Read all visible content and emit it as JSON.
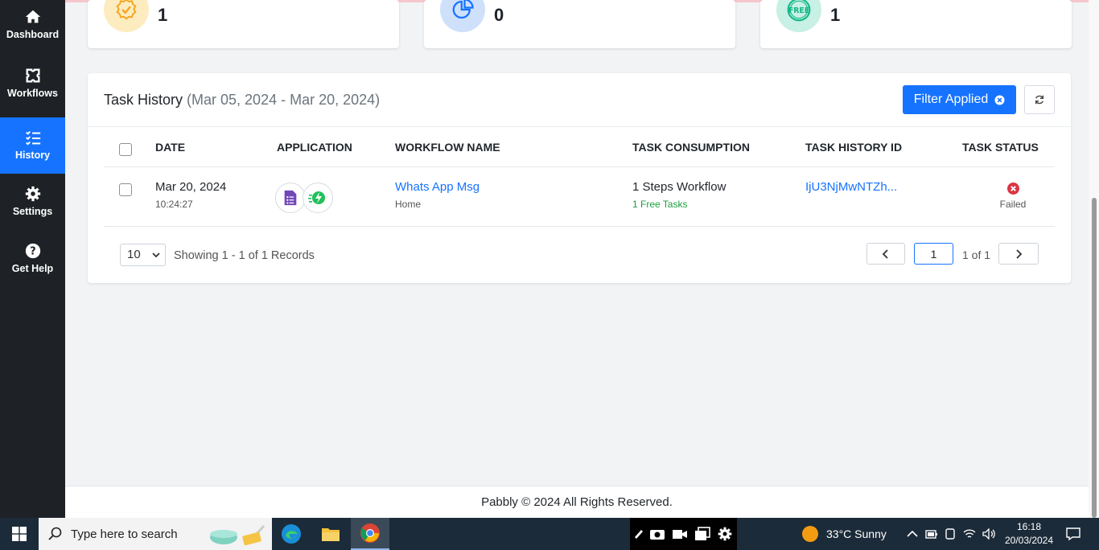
{
  "sidebar": {
    "items": [
      {
        "label": "Dashboard",
        "icon": "home-icon"
      },
      {
        "label": "Workflows",
        "icon": "workflow-icon"
      },
      {
        "label": "History",
        "icon": "list-icon",
        "active": true
      },
      {
        "label": "Settings",
        "icon": "gear-icon"
      },
      {
        "label": "Get Help",
        "icon": "help-icon"
      }
    ]
  },
  "stats": [
    {
      "value": "1",
      "icon": "badge-check-icon",
      "color": "#fdecc0"
    },
    {
      "value": "0",
      "icon": "pie-chart-icon",
      "color": "#cfe0fb"
    },
    {
      "value": "1",
      "icon": "free-badge-icon",
      "color": "#c8f0e4"
    }
  ],
  "task_history": {
    "title": "Task History",
    "range": "(Mar 05, 2024 - Mar 20, 2024)",
    "filter_label": "Filter Applied",
    "columns": [
      "DATE",
      "APPLICATION",
      "WORKFLOW NAME",
      "TASK CONSUMPTION",
      "TASK HISTORY ID",
      "TASK STATUS"
    ],
    "rows": [
      {
        "date": "Mar 20, 2024",
        "time": "10:24:27",
        "applications": [
          "google-forms-icon",
          "pabbly-connect-icon"
        ],
        "workflow_name": "Whats App Msg",
        "workflow_folder": "Home",
        "consumption": "1 Steps Workflow",
        "consumption_sub": "1 Free Tasks",
        "history_id": "IjU3NjMwNTZh...",
        "status": "Failed"
      }
    ],
    "per_page": "10",
    "showing": "Showing 1 - 1 of 1 Records",
    "page": "1",
    "page_of": "1 of 1"
  },
  "footer": "Pabbly © 2024 All Rights Reserved.",
  "taskbar": {
    "search_placeholder": "Type here to search",
    "weather": "33°C  Sunny",
    "time": "16:18",
    "date": "20/03/2024"
  },
  "colors": {
    "accent": "#1673ff",
    "sidebar": "#1e2226",
    "failed": "#dc3545",
    "success": "#1b9e3e"
  }
}
